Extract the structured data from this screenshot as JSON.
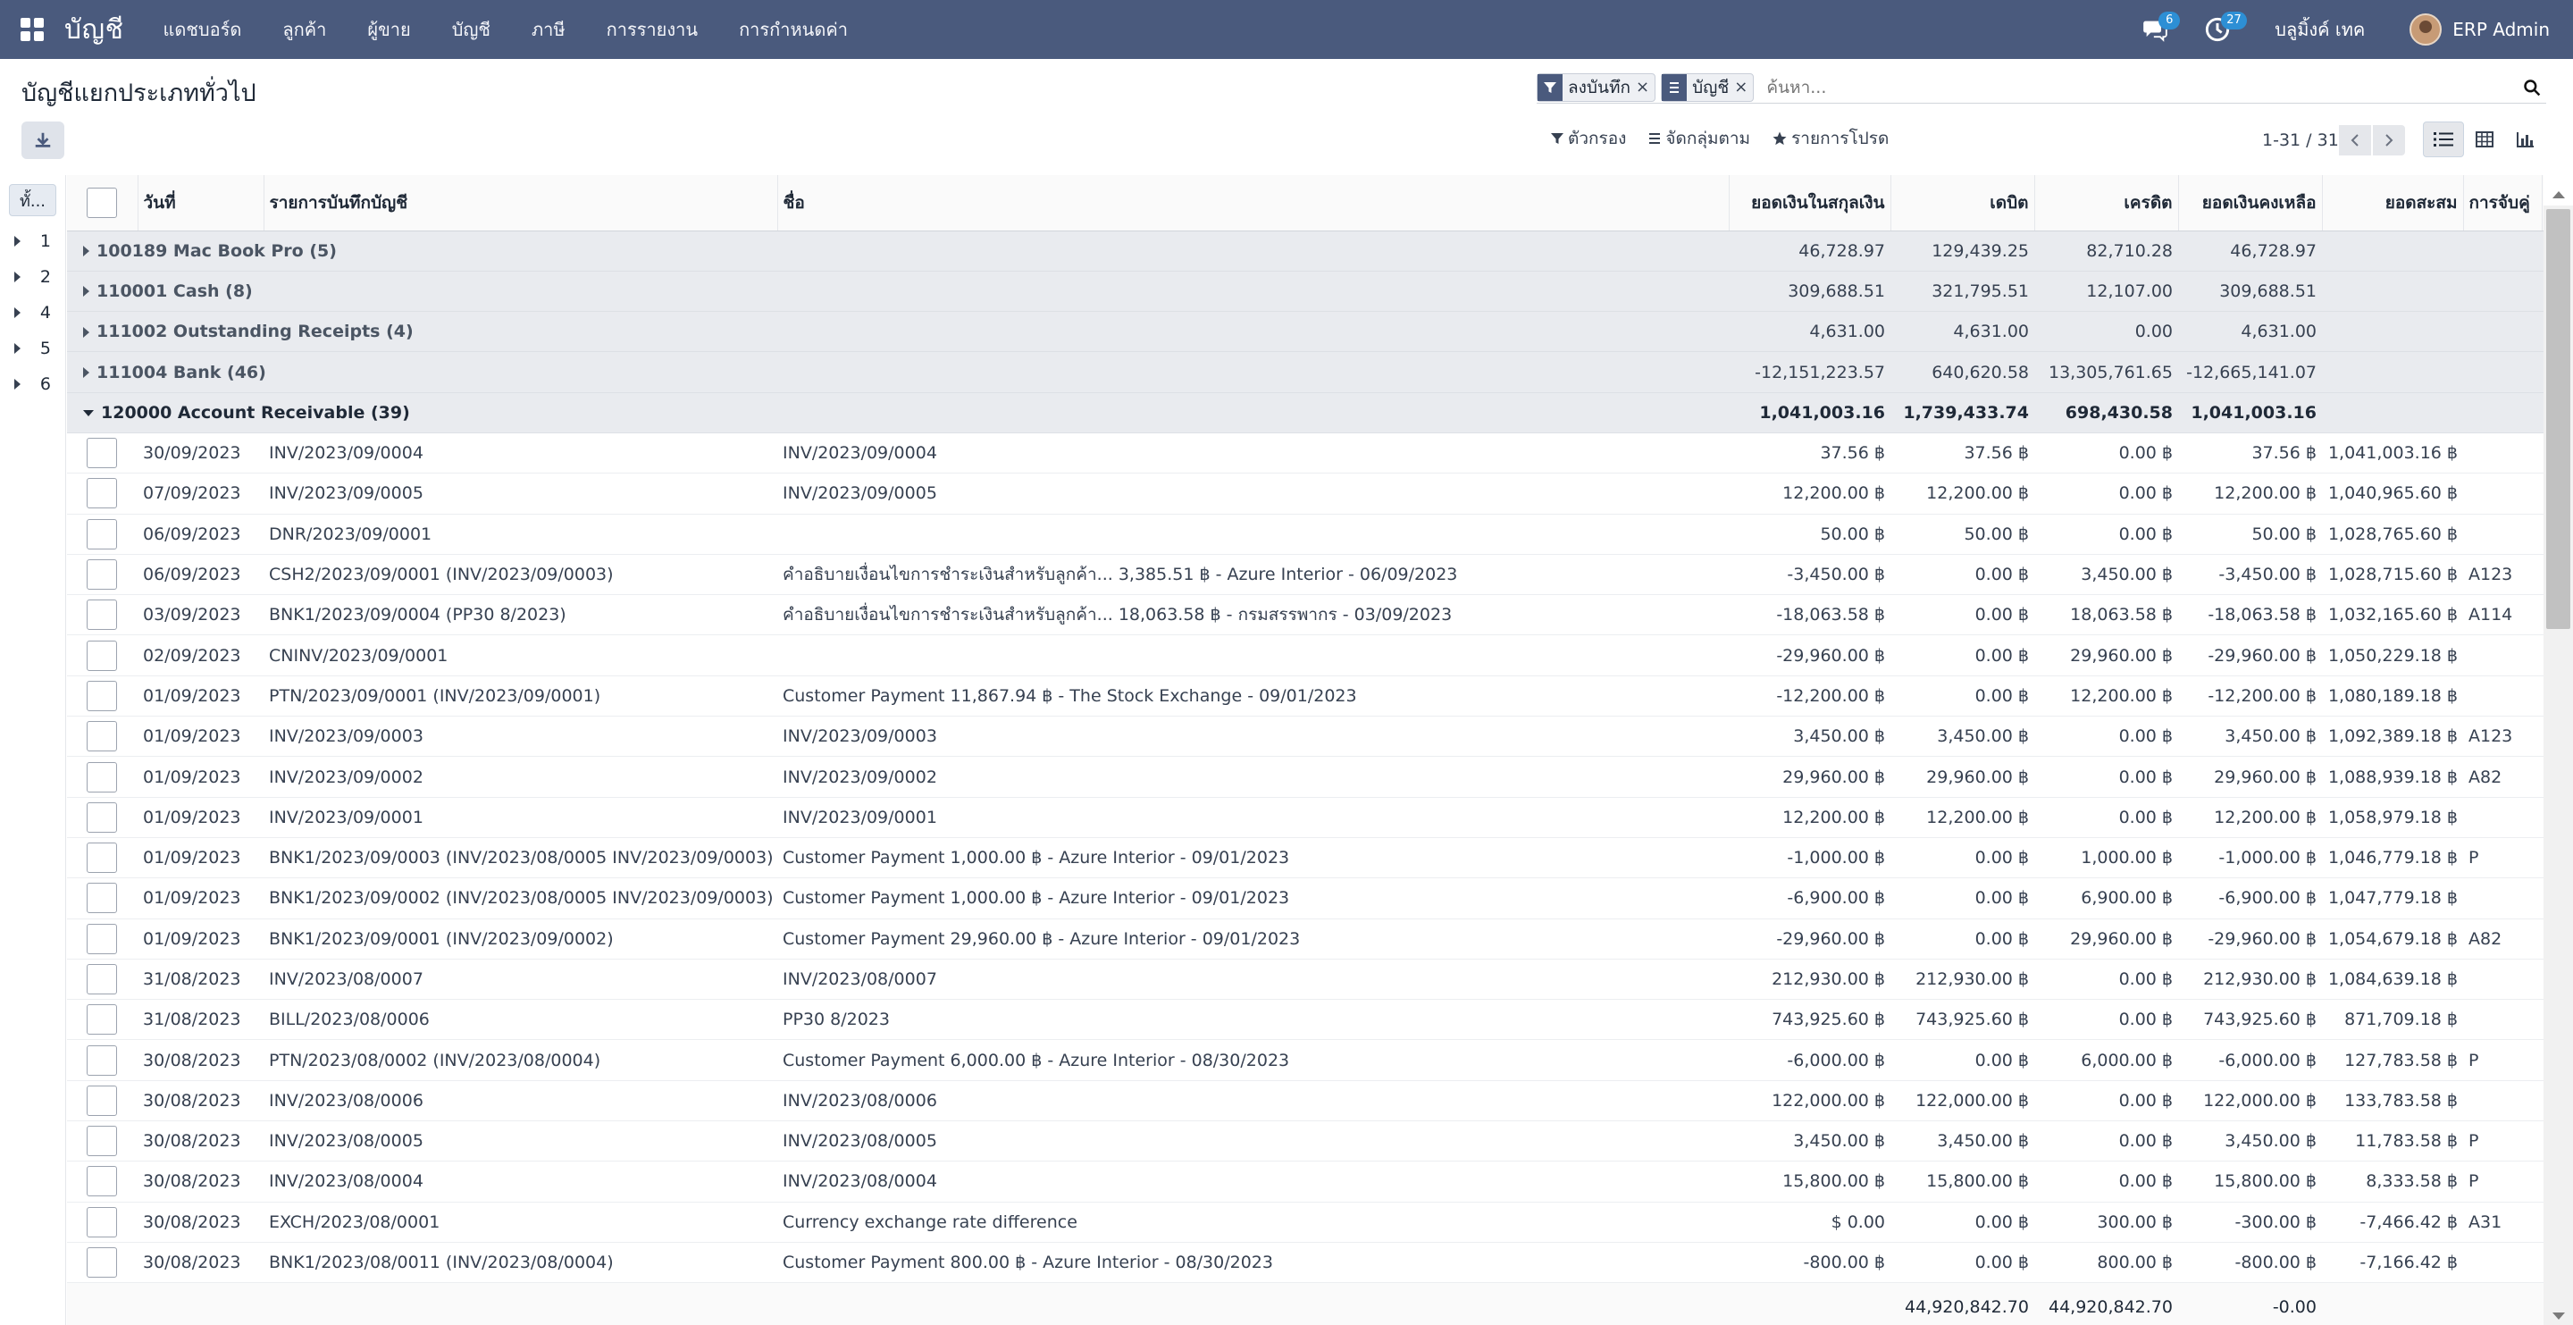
{
  "navbar": {
    "brand": "บัญชี",
    "menu": [
      "แดชบอร์ด",
      "ลูกค้า",
      "ผู้ขาย",
      "บัญชี",
      "ภาษี",
      "การรายงาน",
      "การกำหนดค่า"
    ],
    "messages_count": "6",
    "activities_count": "27",
    "company": "บลูมิ้งค์ เทค",
    "user": "ERP Admin"
  },
  "control": {
    "title": "บัญชีแยกประเภททั่วไป",
    "facets": [
      {
        "icon": "filter-icon",
        "label": "ลงบันทึก"
      },
      {
        "icon": "group-by-icon",
        "label": "บัญชี"
      }
    ],
    "search_placeholder": "ค้นหา...",
    "filters_label": "ตัวกรอง",
    "groupby_label": "จัดกลุ่มตาม",
    "favorites_label": "รายการโปรด",
    "pager": "1-31 / 31"
  },
  "sidepanel": {
    "top": "ทั้...",
    "items": [
      "1",
      "2",
      "4",
      "5",
      "6"
    ]
  },
  "columns": [
    "วันที่",
    "รายการบันทึกบัญชี",
    "ชื่อ",
    "ยอดเงินในสกุลเงิน",
    "เดบิต",
    "เครดิต",
    "ยอดเงินคงเหลือ",
    "ยอดสะสม",
    "การจับคู่"
  ],
  "groups": [
    {
      "name": "100189 Mac Book Pro (5)",
      "amount_currency": "46,728.97",
      "debit": "129,439.25",
      "credit": "82,710.28",
      "balance": "46,728.97",
      "open": false
    },
    {
      "name": "110001 Cash (8)",
      "amount_currency": "309,688.51",
      "debit": "321,795.51",
      "credit": "12,107.00",
      "balance": "309,688.51",
      "open": false
    },
    {
      "name": "111002 Outstanding Receipts (4)",
      "amount_currency": "4,631.00",
      "debit": "4,631.00",
      "credit": "0.00",
      "balance": "4,631.00",
      "open": false
    },
    {
      "name": "111004 Bank (46)",
      "amount_currency": "-12,151,223.57",
      "debit": "640,620.58",
      "credit": "13,305,761.65",
      "balance": "-12,665,141.07",
      "open": false
    },
    {
      "name": "120000 Account Receivable (39)",
      "amount_currency": "1,041,003.16",
      "debit": "1,739,433.74",
      "credit": "698,430.58",
      "balance": "1,041,003.16",
      "open": true
    }
  ],
  "rows": [
    {
      "date": "30/09/2023",
      "move": "INV/2023/09/0004",
      "label": "INV/2023/09/0004",
      "amount_currency": "37.56 ฿",
      "debit": "37.56 ฿",
      "credit": "0.00 ฿",
      "balance": "37.56 ฿",
      "cumulated": "1,041,003.16 ฿",
      "matching": ""
    },
    {
      "date": "07/09/2023",
      "move": "INV/2023/09/0005",
      "label": "INV/2023/09/0005",
      "amount_currency": "12,200.00 ฿",
      "debit": "12,200.00 ฿",
      "credit": "0.00 ฿",
      "balance": "12,200.00 ฿",
      "cumulated": "1,040,965.60 ฿",
      "matching": ""
    },
    {
      "date": "06/09/2023",
      "move": "DNR/2023/09/0001",
      "label": "",
      "amount_currency": "50.00 ฿",
      "debit": "50.00 ฿",
      "credit": "0.00 ฿",
      "balance": "50.00 ฿",
      "cumulated": "1,028,765.60 ฿",
      "matching": ""
    },
    {
      "date": "06/09/2023",
      "move": "CSH2/2023/09/0001 (INV/2023/09/0003)",
      "label": "คำอธิบายเงื่อนไขการชำระเงินสำหรับลูกค้า... 3,385.51 ฿ - Azure Interior - 06/09/2023",
      "amount_currency": "-3,450.00 ฿",
      "debit": "0.00 ฿",
      "credit": "3,450.00 ฿",
      "balance": "-3,450.00 ฿",
      "cumulated": "1,028,715.60 ฿",
      "matching": "A123"
    },
    {
      "date": "03/09/2023",
      "move": "BNK1/2023/09/0004 (PP30 8/2023)",
      "label": "คำอธิบายเงื่อนไขการชำระเงินสำหรับลูกค้า... 18,063.58 ฿ - กรมสรรพากร - 03/09/2023",
      "amount_currency": "-18,063.58 ฿",
      "debit": "0.00 ฿",
      "credit": "18,063.58 ฿",
      "balance": "-18,063.58 ฿",
      "cumulated": "1,032,165.60 ฿",
      "matching": "A114"
    },
    {
      "date": "02/09/2023",
      "move": "CNINV/2023/09/0001",
      "label": "",
      "amount_currency": "-29,960.00 ฿",
      "debit": "0.00 ฿",
      "credit": "29,960.00 ฿",
      "balance": "-29,960.00 ฿",
      "cumulated": "1,050,229.18 ฿",
      "matching": ""
    },
    {
      "date": "01/09/2023",
      "move": "PTN/2023/09/0001 (INV/2023/09/0001)",
      "label": "Customer Payment 11,867.94 ฿ - The Stock Exchange - 09/01/2023",
      "amount_currency": "-12,200.00 ฿",
      "debit": "0.00 ฿",
      "credit": "12,200.00 ฿",
      "balance": "-12,200.00 ฿",
      "cumulated": "1,080,189.18 ฿",
      "matching": ""
    },
    {
      "date": "01/09/2023",
      "move": "INV/2023/09/0003",
      "label": "INV/2023/09/0003",
      "amount_currency": "3,450.00 ฿",
      "debit": "3,450.00 ฿",
      "credit": "0.00 ฿",
      "balance": "3,450.00 ฿",
      "cumulated": "1,092,389.18 ฿",
      "matching": "A123"
    },
    {
      "date": "01/09/2023",
      "move": "INV/2023/09/0002",
      "label": "INV/2023/09/0002",
      "amount_currency": "29,960.00 ฿",
      "debit": "29,960.00 ฿",
      "credit": "0.00 ฿",
      "balance": "29,960.00 ฿",
      "cumulated": "1,088,939.18 ฿",
      "matching": "A82"
    },
    {
      "date": "01/09/2023",
      "move": "INV/2023/09/0001",
      "label": "INV/2023/09/0001",
      "amount_currency": "12,200.00 ฿",
      "debit": "12,200.00 ฿",
      "credit": "0.00 ฿",
      "balance": "12,200.00 ฿",
      "cumulated": "1,058,979.18 ฿",
      "matching": ""
    },
    {
      "date": "01/09/2023",
      "move": "BNK1/2023/09/0003 (INV/2023/08/0005 INV/2023/09/0003)",
      "label": "Customer Payment 1,000.00 ฿ - Azure Interior - 09/01/2023",
      "amount_currency": "-1,000.00 ฿",
      "debit": "0.00 ฿",
      "credit": "1,000.00 ฿",
      "balance": "-1,000.00 ฿",
      "cumulated": "1,046,779.18 ฿",
      "matching": "P"
    },
    {
      "date": "01/09/2023",
      "move": "BNK1/2023/09/0002 (INV/2023/08/0005 INV/2023/09/0003)",
      "label": "Customer Payment 1,000.00 ฿ - Azure Interior - 09/01/2023",
      "amount_currency": "-6,900.00 ฿",
      "debit": "0.00 ฿",
      "credit": "6,900.00 ฿",
      "balance": "-6,900.00 ฿",
      "cumulated": "1,047,779.18 ฿",
      "matching": ""
    },
    {
      "date": "01/09/2023",
      "move": "BNK1/2023/09/0001 (INV/2023/09/0002)",
      "label": "Customer Payment 29,960.00 ฿ - Azure Interior - 09/01/2023",
      "amount_currency": "-29,960.00 ฿",
      "debit": "0.00 ฿",
      "credit": "29,960.00 ฿",
      "balance": "-29,960.00 ฿",
      "cumulated": "1,054,679.18 ฿",
      "matching": "A82"
    },
    {
      "date": "31/08/2023",
      "move": "INV/2023/08/0007",
      "label": "INV/2023/08/0007",
      "amount_currency": "212,930.00 ฿",
      "debit": "212,930.00 ฿",
      "credit": "0.00 ฿",
      "balance": "212,930.00 ฿",
      "cumulated": "1,084,639.18 ฿",
      "matching": ""
    },
    {
      "date": "31/08/2023",
      "move": "BILL/2023/08/0006",
      "label": "PP30 8/2023",
      "amount_currency": "743,925.60 ฿",
      "debit": "743,925.60 ฿",
      "credit": "0.00 ฿",
      "balance": "743,925.60 ฿",
      "cumulated": "871,709.18 ฿",
      "matching": ""
    },
    {
      "date": "30/08/2023",
      "move": "PTN/2023/08/0002 (INV/2023/08/0004)",
      "label": "Customer Payment 6,000.00 ฿ - Azure Interior - 08/30/2023",
      "amount_currency": "-6,000.00 ฿",
      "debit": "0.00 ฿",
      "credit": "6,000.00 ฿",
      "balance": "-6,000.00 ฿",
      "cumulated": "127,783.58 ฿",
      "matching": "P"
    },
    {
      "date": "30/08/2023",
      "move": "INV/2023/08/0006",
      "label": "INV/2023/08/0006",
      "amount_currency": "122,000.00 ฿",
      "debit": "122,000.00 ฿",
      "credit": "0.00 ฿",
      "balance": "122,000.00 ฿",
      "cumulated": "133,783.58 ฿",
      "matching": ""
    },
    {
      "date": "30/08/2023",
      "move": "INV/2023/08/0005",
      "label": "INV/2023/08/0005",
      "amount_currency": "3,450.00 ฿",
      "debit": "3,450.00 ฿",
      "credit": "0.00 ฿",
      "balance": "3,450.00 ฿",
      "cumulated": "11,783.58 ฿",
      "matching": "P"
    },
    {
      "date": "30/08/2023",
      "move": "INV/2023/08/0004",
      "label": "INV/2023/08/0004",
      "amount_currency": "15,800.00 ฿",
      "debit": "15,800.00 ฿",
      "credit": "0.00 ฿",
      "balance": "15,800.00 ฿",
      "cumulated": "8,333.58 ฿",
      "matching": "P"
    },
    {
      "date": "30/08/2023",
      "move": "EXCH/2023/08/0001",
      "label": "Currency exchange rate difference",
      "amount_currency": "$ 0.00",
      "debit": "0.00 ฿",
      "credit": "300.00 ฿",
      "balance": "-300.00 ฿",
      "cumulated": "-7,466.42 ฿",
      "matching": "A31"
    },
    {
      "date": "30/08/2023",
      "move": "BNK1/2023/08/0011 (INV/2023/08/0004)",
      "label": "Customer Payment 800.00 ฿ - Azure Interior - 08/30/2023",
      "amount_currency": "-800.00 ฿",
      "debit": "0.00 ฿",
      "credit": "800.00 ฿",
      "balance": "-800.00 ฿",
      "cumulated": "-7,166.42 ฿",
      "matching": ""
    }
  ],
  "totals": {
    "debit": "44,920,842.70",
    "credit": "44,920,842.70",
    "balance": "-0.00"
  },
  "colors": {
    "navbar": "#4a5a7d",
    "group_row": "#e9ebef",
    "badge": "#2d8fd5"
  }
}
